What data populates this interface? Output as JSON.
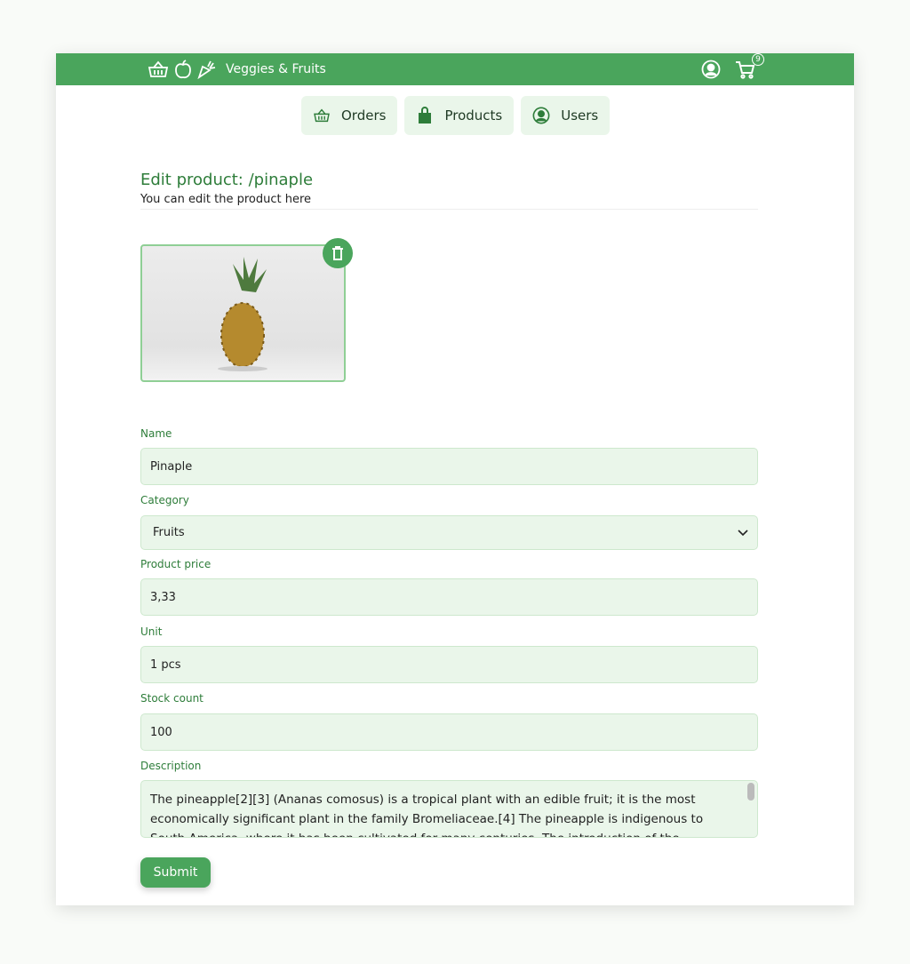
{
  "header": {
    "title": "Veggies & Fruits",
    "cart_count": "9",
    "brand_color": "#4aa55c"
  },
  "nav": {
    "tabs": [
      {
        "label": "Orders",
        "icon": "basket-icon"
      },
      {
        "label": "Products",
        "icon": "shopping-bag-icon"
      },
      {
        "label": "Users",
        "icon": "user-circle-icon"
      }
    ]
  },
  "page": {
    "title": "Edit product: /pinaple",
    "subtitle": "You can edit the product here"
  },
  "form": {
    "name": {
      "label": "Name",
      "value": "Pinaple"
    },
    "category": {
      "label": "Category",
      "value": "Fruits"
    },
    "price": {
      "label": "Product price",
      "value": "3,33"
    },
    "unit": {
      "label": "Unit",
      "value": "1 pcs"
    },
    "stock": {
      "label": "Stock count",
      "value": "100"
    },
    "description": {
      "label": "Description",
      "value": "The pineapple[2][3] (Ananas comosus) is a tropical plant with an edible fruit; it is the most economically significant plant in the family Bromeliaceae.[4] The pineapple is indigenous to South America, where it has been cultivated for many centuries. The introduction of the pineapple to Europe"
    },
    "submit": "Submit"
  }
}
